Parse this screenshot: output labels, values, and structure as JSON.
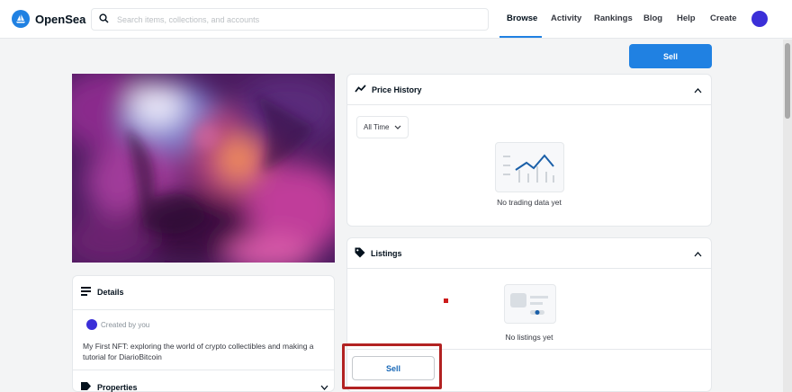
{
  "nav": {
    "logo_text": "OpenSea",
    "search_placeholder": "Search items, collections, and accounts",
    "links": [
      {
        "label": "Browse",
        "active": true
      },
      {
        "label": "Activity"
      },
      {
        "label": "Rankings"
      },
      {
        "label": "Blog"
      },
      {
        "label": "Help"
      },
      {
        "label": "Create"
      }
    ]
  },
  "actions": {
    "sell_top_label": "Sell",
    "sell_bottom_label": "Sell"
  },
  "details": {
    "title": "Details",
    "created_by": "Created by you",
    "description": "My First NFT: exploring the world of crypto collectibles and making a tutorial for DiarioBitcoin",
    "properties_title": "Properties"
  },
  "price_history": {
    "title": "Price History",
    "time_filter": "All Time",
    "empty_text": "No trading data yet"
  },
  "listings": {
    "title": "Listings",
    "empty_text": "No listings yet"
  },
  "colors": {
    "accent": "#2081e2",
    "highlight": "#b22222"
  }
}
